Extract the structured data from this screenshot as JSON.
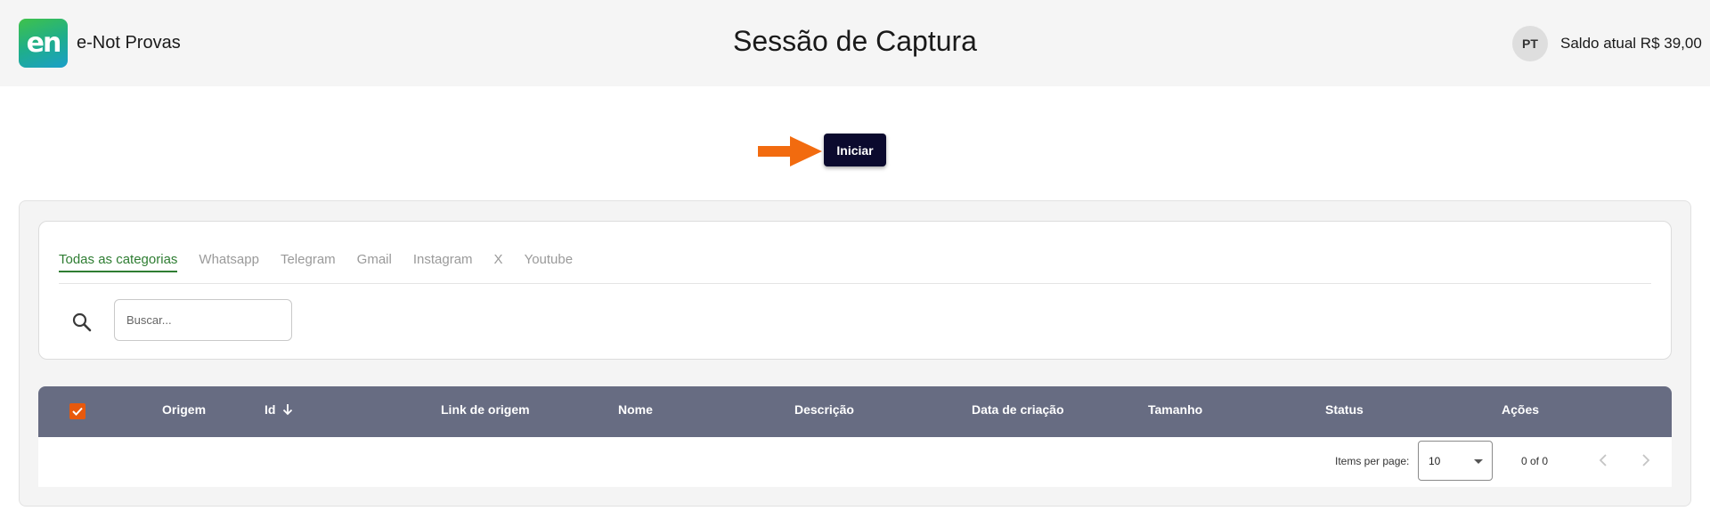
{
  "header": {
    "logo_text": "en",
    "brand_name": "e-Not Provas",
    "page_title": "Sessão de Captura",
    "avatar_initials": "PT",
    "balance_text": "Saldo atual R$ 39,00"
  },
  "actions": {
    "start_label": "Iniciar",
    "arrow_icon": "arrow-right-icon"
  },
  "filters": {
    "tabs": [
      {
        "label": "Todas as categorias",
        "active": true
      },
      {
        "label": "Whatsapp",
        "active": false
      },
      {
        "label": "Telegram",
        "active": false
      },
      {
        "label": "Gmail",
        "active": false
      },
      {
        "label": "Instagram",
        "active": false
      },
      {
        "label": "X",
        "active": false
      },
      {
        "label": "Youtube",
        "active": false
      }
    ],
    "search_placeholder": "Buscar...",
    "search_value": ""
  },
  "table": {
    "columns": [
      "Origem",
      "Id",
      "Link de origem",
      "Nome",
      "Descrição",
      "Data de criação",
      "Tamanho",
      "Status",
      "Ações"
    ],
    "sort_column": "Id",
    "sort_direction": "descending",
    "select_all_checked": true,
    "rows": []
  },
  "pagination": {
    "items_per_page_label": "Items per page:",
    "items_per_page_value": "10",
    "range_text": "0 of 0"
  },
  "colors": {
    "accent_green": "#2e7d32",
    "start_button": "#0b0a2e",
    "arrow": "#f26b0f",
    "table_header": "#676c82",
    "checkbox": "#e8590c"
  }
}
